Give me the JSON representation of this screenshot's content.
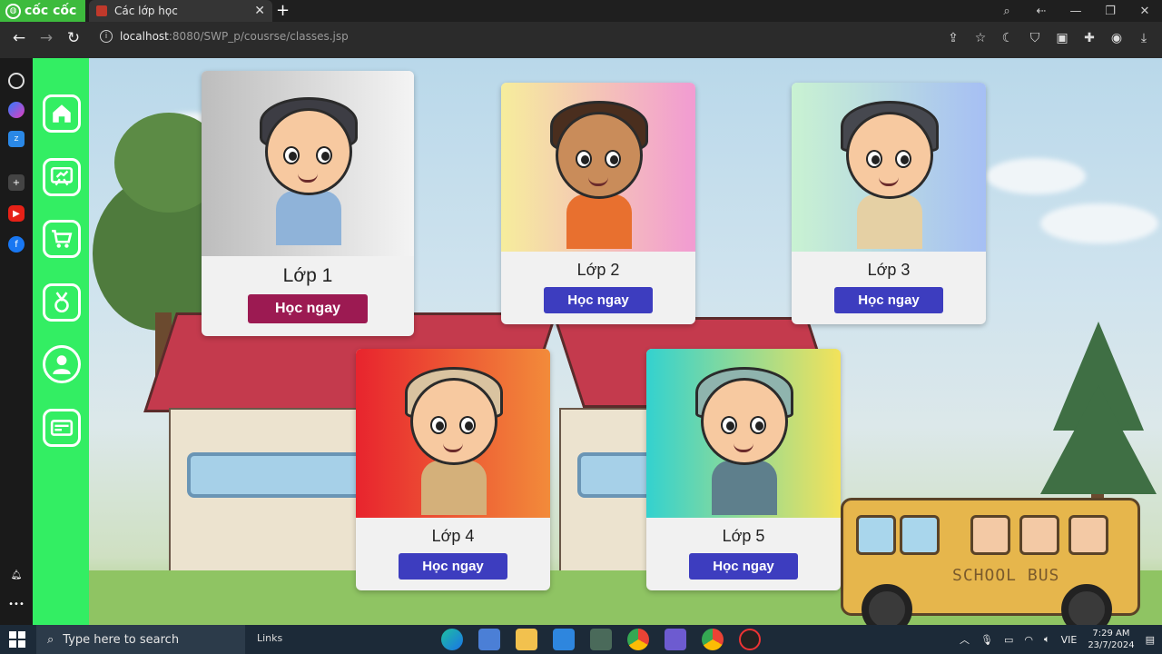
{
  "browser": {
    "brand": "cốc cốc",
    "tab_title": "Các lớp học",
    "tab_close": "✕",
    "new_tab": "+",
    "url_host": "localhost",
    "url_path": ":8080/SWP_p/cousrse/classes.jsp"
  },
  "cards": [
    {
      "title": "Lớp 1",
      "button": "Học ngay",
      "button_color": "#9c1a52"
    },
    {
      "title": "Lớp 2",
      "button": "Học ngay",
      "button_color": "#3d3dbf"
    },
    {
      "title": "Lớp 3",
      "button": "Học ngay",
      "button_color": "#3d3dbf"
    },
    {
      "title": "Lớp 4",
      "button": "Học ngay",
      "button_color": "#3d3dbf"
    },
    {
      "title": "Lớp 5",
      "button": "Học ngay",
      "button_color": "#3d3dbf"
    }
  ],
  "bus_text": "SCHOOL BUS",
  "taskbar": {
    "search_placeholder": "Type here to search",
    "links": "Links",
    "lang": "VIE",
    "time": "7:29 AM",
    "date": "23/7/2024"
  },
  "colors": {
    "app_sidebar": "#33ee63",
    "brand": "#3dbb3d"
  }
}
